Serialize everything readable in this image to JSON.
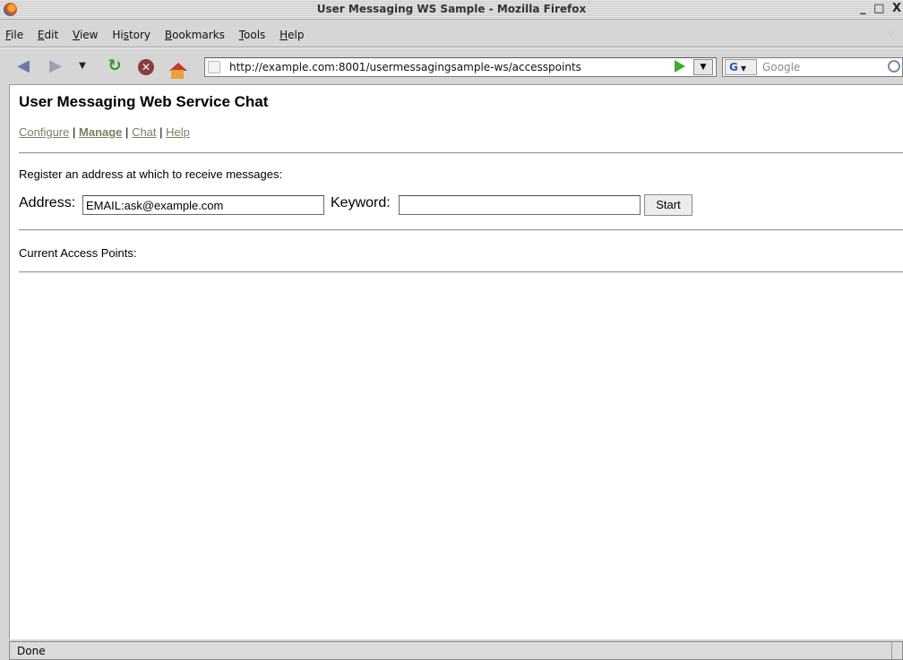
{
  "window": {
    "title": "User Messaging WS Sample - Mozilla Firefox",
    "controls": "_ □ X"
  },
  "menubar": {
    "items": [
      "File",
      "Edit",
      "View",
      "History",
      "Bookmarks",
      "Tools",
      "Help"
    ],
    "mnemonics": [
      "F",
      "E",
      "V",
      "s",
      "B",
      "T",
      "H"
    ]
  },
  "navbar": {
    "url": "http://example.com:8001/usermessagingsample-ws/accesspoints",
    "search_engine": "G",
    "search_placeholder": "Google"
  },
  "page": {
    "title": "User Messaging Web Service Chat",
    "nav": {
      "configure": "Configure",
      "manage": "Manage",
      "chat": "Chat",
      "help": "Help",
      "separator": "|"
    },
    "register_text": "Register an address at which to receive messages:",
    "address_label": "Address:",
    "address_value": "EMAIL:ask@example.com",
    "keyword_label": "Keyword:",
    "keyword_value": "",
    "start_label": "Start",
    "access_points_label": "Current Access Points:"
  },
  "statusbar": {
    "status": "Done"
  },
  "colors": {
    "link": "#7a8060",
    "go_arrow": "#3fae2a",
    "page_bg": "#ffffff"
  }
}
